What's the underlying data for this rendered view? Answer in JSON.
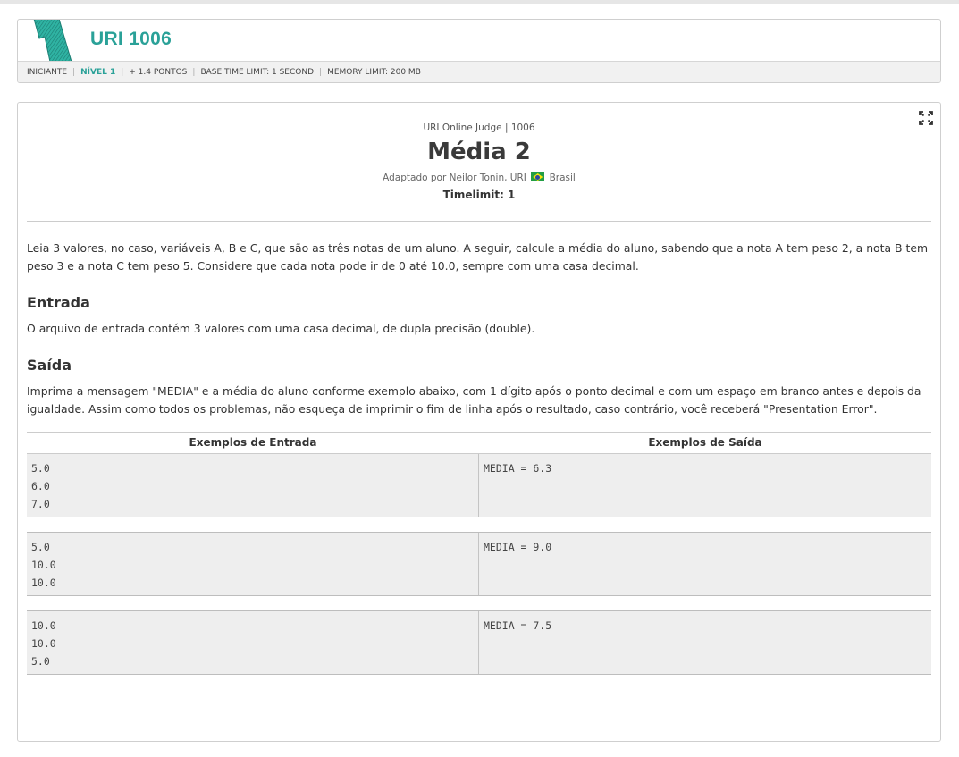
{
  "header": {
    "code": "URI 1006",
    "meta": {
      "category": "INICIANTE",
      "level": "NÍVEL 1",
      "points": "+ 1.4 PONTOS",
      "time_limit": "BASE TIME LIMIT: 1 SECOND",
      "memory_limit": "MEMORY LIMIT: 200 MB"
    }
  },
  "problem": {
    "judge_line": "URI Online Judge | 1006",
    "title": "Média 2",
    "adapted_prefix": "Adaptado por Neilor Tonin, URI",
    "adapted_country": "Brasil",
    "timelimit": "Timelimit: 1",
    "description": "Leia 3 valores, no caso, variáveis A, B e C, que são as três notas de um aluno. A seguir, calcule a média do aluno, sabendo que a nota A tem peso 2, a nota B tem peso 3 e a nota C tem peso 5. Considere que cada nota pode ir de 0 até 10.0, sempre com uma casa decimal.",
    "input_heading": "Entrada",
    "input_text": "O arquivo de entrada contém 3 valores com uma casa decimal, de dupla precisão (double).",
    "output_heading": "Saída",
    "output_text": "Imprima a mensagem \"MEDIA\" e a média do aluno conforme exemplo abaixo, com 1 dígito após o ponto decimal e com um espaço em branco antes e depois da igualdade. Assim como todos os problemas, não esqueça de imprimir o fim de linha após o resultado, caso contrário, você receberá \"Presentation Error\"."
  },
  "examples": {
    "input_header": "Exemplos de Entrada",
    "output_header": "Exemplos de Saída",
    "cases": [
      {
        "input": "5.0\n6.0\n7.0",
        "output": "MEDIA = 6.3"
      },
      {
        "input": "5.0\n10.0\n10.0",
        "output": "MEDIA = 9.0"
      },
      {
        "input": "10.0\n10.0\n5.0",
        "output": "MEDIA = 7.5"
      }
    ]
  },
  "icons": {
    "logo": "uri-number-one-logo",
    "expand": "expand-fullscreen-icon",
    "flag": "brazil-flag-icon"
  },
  "colors": {
    "accent": "#2aa198",
    "example_bg": "#eeeeee"
  }
}
